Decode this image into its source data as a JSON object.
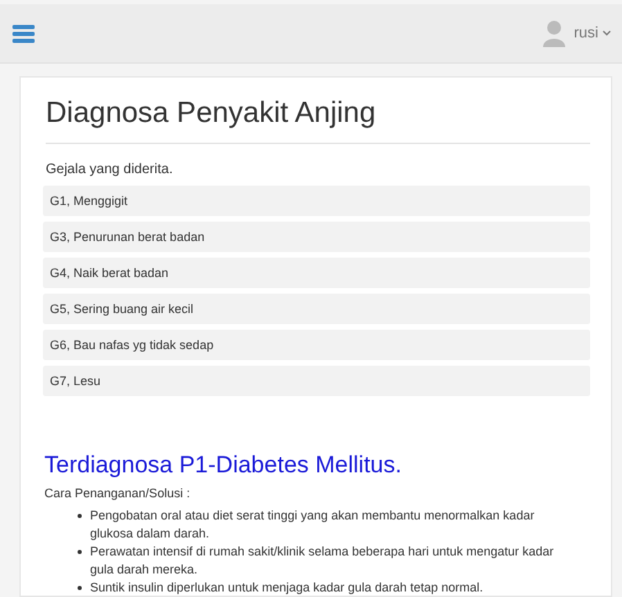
{
  "header": {
    "user": "rusi"
  },
  "title": "Diagnosa Penyakit Anjing",
  "symptoms_label": "Gejala yang diderita.",
  "symptoms": [
    "G1, Menggigit",
    "G3, Penurunan berat badan",
    "G4, Naik berat badan",
    "G5, Sering buang air kecil",
    "G6, Bau nafas yg tidak sedap",
    "G7, Lesu"
  ],
  "result": {
    "heading": "Terdiagnosa P1-Diabetes Mellitus.",
    "solution_label": "Cara Penanganan/Solusi :",
    "solutions": [
      "Pengobatan oral atau diet serat tinggi yang akan membantu menormalkan kadar glukosa dalam darah.",
      "Perawatan intensif di rumah sakit/klinik selama beberapa hari untuk mengatur kadar gula darah mereka.",
      "Suntik insulin diperlukan untuk menjaga kadar gula darah tetap normal."
    ]
  }
}
